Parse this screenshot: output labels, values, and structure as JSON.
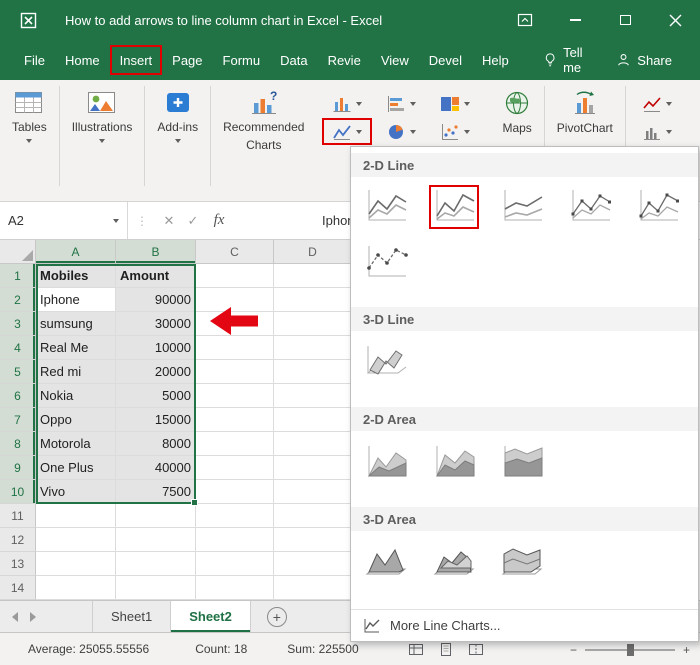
{
  "titlebar": {
    "title": "How to add arrows to line  column chart in Excel  -  Excel"
  },
  "ribbon_tabs": {
    "items": [
      "File",
      "Home",
      "Insert",
      "Page",
      "Formu",
      "Data",
      "Revie",
      "View",
      "Devel",
      "Help"
    ],
    "tell_me": "Tell me",
    "share": "Share"
  },
  "ribbon_groups": {
    "tables": "Tables",
    "illustrations": "Illustrations",
    "addins": "Add-ins",
    "recommended_line1": "Recommended",
    "recommended_line2": "Charts",
    "maps": "Maps",
    "pivotchart": "PivotChart"
  },
  "formula_bar": {
    "name_box": "A2",
    "cancel": "✕",
    "enter": "✓",
    "fx_label": "fx",
    "value": "Iphone"
  },
  "sheet": {
    "col_headers": [
      "A",
      "B",
      "C",
      "D"
    ],
    "row_count": 14,
    "selection": "A1:B10",
    "active_cell": "A2",
    "rows": [
      {
        "a": "Mobiles",
        "b": "Amount"
      },
      {
        "a": "Iphone",
        "b": "90000"
      },
      {
        "a": "sumsung",
        "b": "30000"
      },
      {
        "a": "Real Me",
        "b": "10000"
      },
      {
        "a": "Red mi",
        "b": "20000"
      },
      {
        "a": "Nokia",
        "b": "5000"
      },
      {
        "a": "Oppo",
        "b": "15000"
      },
      {
        "a": "Motorola",
        "b": "8000"
      },
      {
        "a": "One Plus",
        "b": "40000"
      },
      {
        "a": "Vivo",
        "b": "7500"
      }
    ]
  },
  "chart_menu": {
    "sections": [
      {
        "label": "2-D Line"
      },
      {
        "label": "3-D Line"
      },
      {
        "label": "2-D Area"
      },
      {
        "label": "3-D Area"
      }
    ],
    "more_label": "More Line Charts..."
  },
  "sheet_tabs": {
    "items": [
      "Sheet1",
      "Sheet2"
    ],
    "active": "Sheet2"
  },
  "status_bar": {
    "average": "Average: 25055.55556",
    "count": "Count: 18",
    "sum": "Sum: 225500"
  },
  "icons": {
    "zoom_out": "−",
    "zoom_in": "+",
    "new_sheet": "+"
  },
  "colors": {
    "excel_green": "#217346",
    "annotation_red": "#e00000",
    "selection_fill": "#e4e4e4"
  }
}
